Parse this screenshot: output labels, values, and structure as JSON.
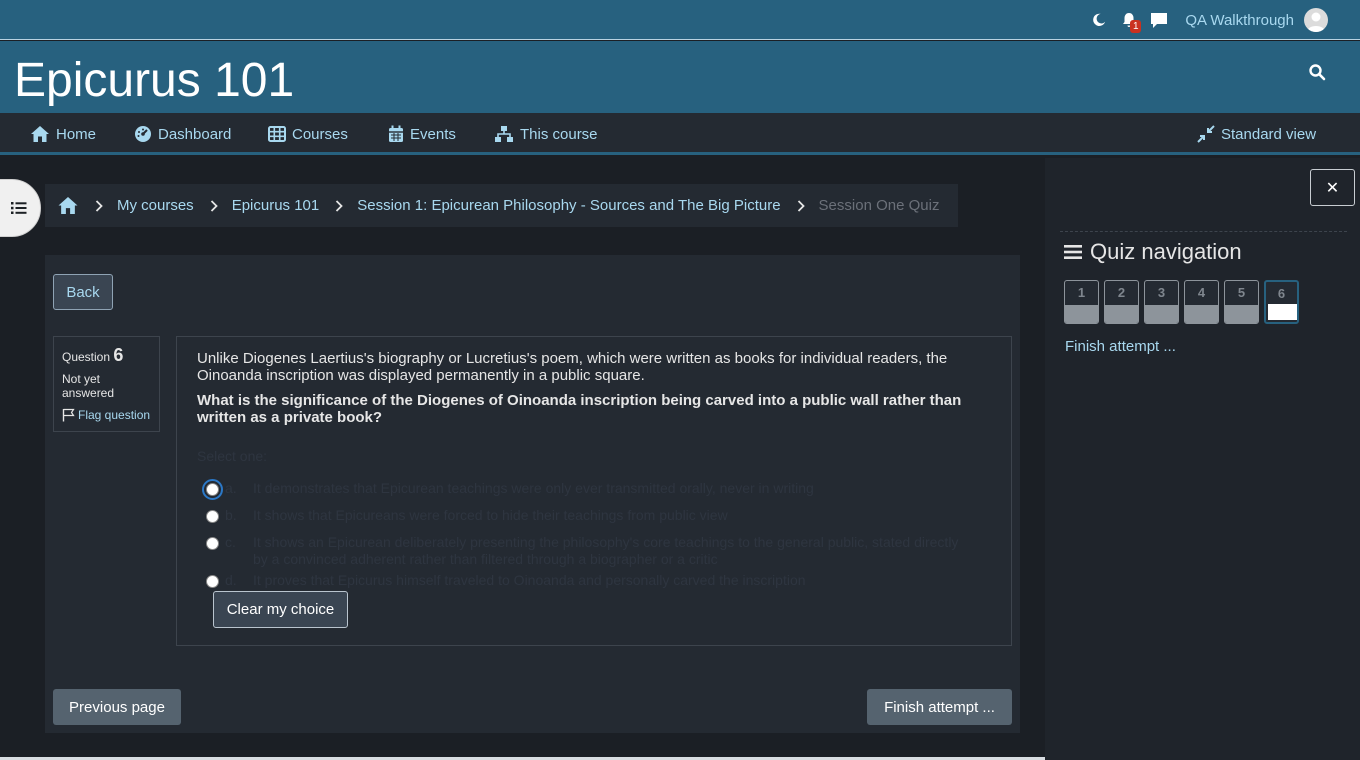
{
  "topbar": {
    "notification_count": "1",
    "user_name": "QA Walkthrough"
  },
  "header": {
    "site_title": "Epicurus 101"
  },
  "nav": {
    "items": [
      {
        "label": "Home",
        "icon": "home-icon"
      },
      {
        "label": "Dashboard",
        "icon": "dashboard-icon"
      },
      {
        "label": "Courses",
        "icon": "courses-icon"
      },
      {
        "label": "Events",
        "icon": "calendar-icon"
      },
      {
        "label": "This course",
        "icon": "sitemap-icon"
      }
    ],
    "view_toggle": "Standard view"
  },
  "breadcrumb": {
    "items": [
      "My courses",
      "Epicurus 101",
      "Session 1: Epicurean Philosophy - Sources and The Big Picture"
    ],
    "current": "Session One Quiz"
  },
  "quiz": {
    "back_label": "Back",
    "question_label": "Question",
    "question_number": "6",
    "state": "Not yet answered",
    "flag_label": "Flag question",
    "question_text": "Unlike Diogenes Laertius's biography or Lucretius's poem, which were written as books for individual readers, the Oinoanda inscription was displayed permanently in a public square.",
    "prompt": "What is the significance of the Diogenes of Oinoanda inscription being carved into a public wall rather than written as a private book?",
    "select_one": "Select one:",
    "answers": [
      {
        "letter": "a.",
        "text": "It demonstrates that Epicurean teachings were only ever transmitted orally, never in writing"
      },
      {
        "letter": "b.",
        "text": "It shows that Epicureans were forced to hide their teachings from public view"
      },
      {
        "letter": "c.",
        "text": "It shows an Epicurean deliberately presenting the philosophy's core teachings to the general public, stated directly by a convinced adherent rather than filtered through a biographer or a critic"
      },
      {
        "letter": "d.",
        "text": "It proves that Epicurus himself traveled to Oinoanda and personally carved the inscription"
      }
    ],
    "clear_label": "Clear my choice",
    "prev_label": "Previous page",
    "finish_label": "Finish attempt ..."
  },
  "quiz_nav": {
    "title": "Quiz navigation",
    "close_label": "✕",
    "buttons": [
      "1",
      "2",
      "3",
      "4",
      "5",
      "6"
    ],
    "current": "6",
    "finish_link": "Finish attempt ..."
  },
  "colors": {
    "brand": "#27617f",
    "link": "#a8d8ef",
    "background": "#1b1f25",
    "panel": "#242a32"
  }
}
